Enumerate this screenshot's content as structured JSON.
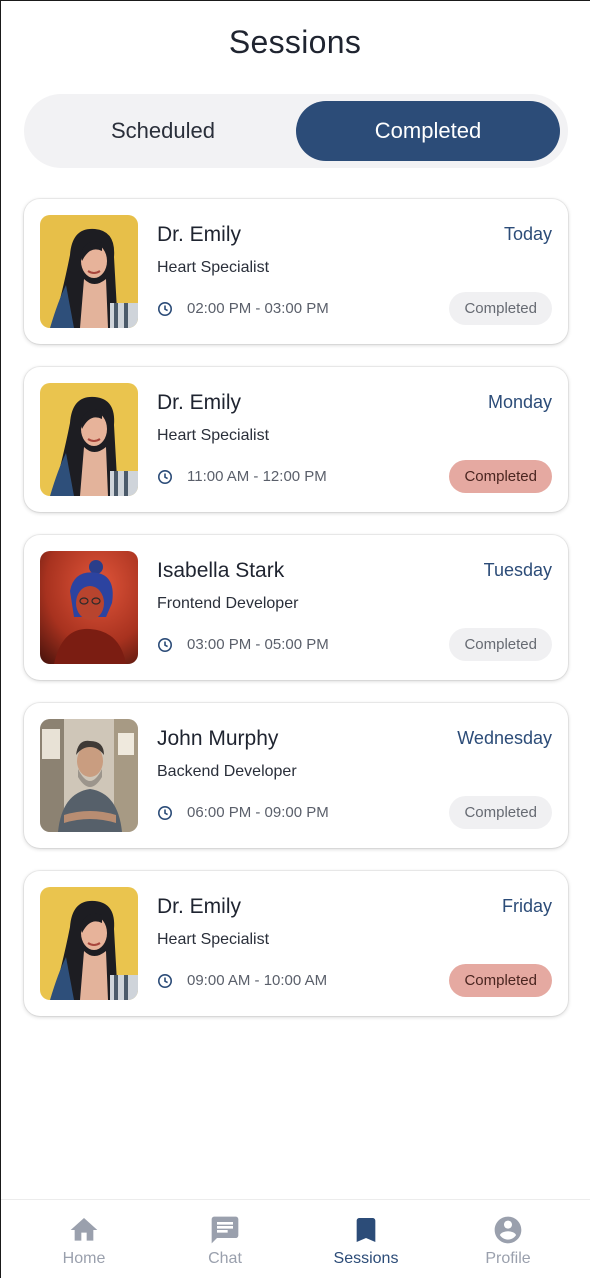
{
  "header": {
    "title": "Sessions"
  },
  "tabs": {
    "scheduled": "Scheduled",
    "completed": "Completed"
  },
  "sessions": [
    {
      "name": "Dr. Emily",
      "role": "Heart Specialist",
      "day": "Today",
      "time": "02:00 PM - 03:00 PM",
      "status": "Completed",
      "status_highlight": false,
      "avatar": "woman-yellow-bg-photo"
    },
    {
      "name": "Dr. Emily",
      "role": "Heart Specialist",
      "day": "Monday",
      "time": "11:00 AM - 12:00 PM",
      "status": "Completed",
      "status_highlight": true,
      "avatar": "woman-yellow-bg-photo"
    },
    {
      "name": "Isabella Stark",
      "role": "Frontend Developer",
      "day": "Tuesday",
      "time": "03:00 PM - 05:00 PM",
      "status": "Completed",
      "status_highlight": false,
      "avatar": "person-red-light-photo"
    },
    {
      "name": "John Murphy",
      "role": "Backend Developer",
      "day": "Wednesday",
      "time": "06:00 PM - 09:00 PM",
      "status": "Completed",
      "status_highlight": false,
      "avatar": "bearded-man-photo"
    },
    {
      "name": "Dr. Emily",
      "role": "Heart Specialist",
      "day": "Friday",
      "time": "09:00 AM - 10:00 AM",
      "status": "Completed",
      "status_highlight": true,
      "avatar": "woman-yellow-bg-photo"
    }
  ],
  "nav": {
    "home": "Home",
    "chat": "Chat",
    "sessions": "Sessions",
    "profile": "Profile",
    "icons": {
      "home": "home-icon",
      "chat": "chat-icon",
      "sessions": "bookmark-icon",
      "profile": "account-circle-icon"
    }
  },
  "colors": {
    "accent": "#2c4c78",
    "status_highlight": "#e5a9a1",
    "status_default": "#f0f0f2",
    "nav_inactive": "#9aa0ad"
  }
}
